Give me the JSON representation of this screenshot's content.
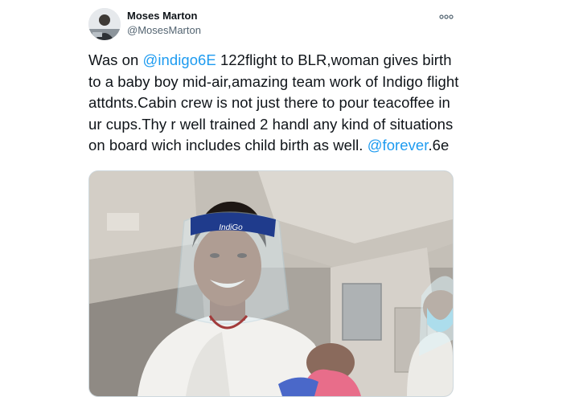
{
  "author": {
    "name": "Moses Marton",
    "handle": "@MosesMarton"
  },
  "tweet": {
    "t1": "Was on ",
    "mention1": "@indigo6E",
    "t2": " 122flight to BLR,woman gives birth to a baby boy mid-air,amazing team work of Indigo flight attdnts.Cabin crew is not just there to pour teacoffee in ur cups.Thy r well trained 2 handl any kind of situations on board wich includes child birth as well. ",
    "mention2": "@forever",
    "t3": ".6e"
  },
  "media": {
    "shield_logo": "IndiGo"
  },
  "icons": {
    "more": "more-options-icon"
  },
  "colors": {
    "link": "#1d9bf0",
    "text": "#0f1419",
    "secondary": "#536471"
  }
}
